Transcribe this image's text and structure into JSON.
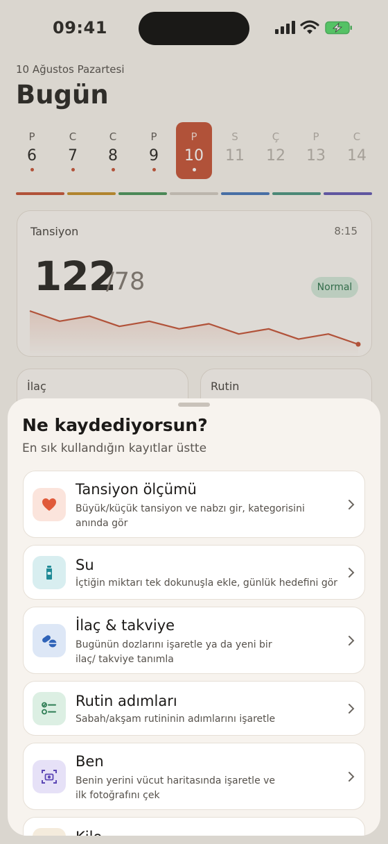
{
  "status_bar": {
    "time": "09:41"
  },
  "header": {
    "date": "10 Ağustos Pazartesi",
    "title": "Bugün"
  },
  "week": [
    {
      "letter": "P",
      "number": "6",
      "state": "past"
    },
    {
      "letter": "C",
      "number": "7",
      "state": "past"
    },
    {
      "letter": "C",
      "number": "8",
      "state": "past"
    },
    {
      "letter": "P",
      "number": "9",
      "state": "past"
    },
    {
      "letter": "P",
      "number": "10",
      "state": "today"
    },
    {
      "letter": "S",
      "number": "11",
      "state": "future"
    },
    {
      "letter": "Ç",
      "number": "12",
      "state": "future"
    },
    {
      "letter": "P",
      "number": "13",
      "state": "future"
    },
    {
      "letter": "C",
      "number": "14",
      "state": "future"
    }
  ],
  "category_colors": [
    "#c2492c",
    "#c28a1e",
    "#3f8f52",
    "#cfc8bf",
    "#3b6fb6",
    "#3f8f7a",
    "#5a4fb0"
  ],
  "bp_card": {
    "title": "Tansiyon",
    "time": "8:15",
    "systolic": "122",
    "diastolic": "/78",
    "status": "Normal",
    "trend": [
      15,
      17,
      16,
      18,
      17,
      18.5,
      17.5,
      19.5,
      18.5,
      20.5,
      19.5,
      21.5
    ]
  },
  "small_cards": {
    "medication": "İlaç",
    "routine": "Rutin"
  },
  "sheet": {
    "title": "Ne kaydediyorsun?",
    "subtitle": "En sık kullandığın kayıtlar üstte",
    "items": [
      {
        "title": "Tansiyon ölçümü",
        "desc": "Büyük/küçük tansiyon ve nabzı gir, kategorisini anında gör",
        "icon": "heart-icon",
        "color": "#e05a3a",
        "bg": "#fbe4dc"
      },
      {
        "title": "Su",
        "desc": "İçtiğin miktarı tek dokunuşla ekle, günlük hedefini gör",
        "icon": "water-bottle-icon",
        "color": "#1f8a96",
        "bg": "#d8eef0"
      },
      {
        "title": "İlaç & takviye",
        "desc": "Bugünün dozlarını işaretle ya da yeni bir ilaç/ takviye tanımla",
        "icon": "pills-icon",
        "color": "#2f63b8",
        "bg": "#dde7f6"
      },
      {
        "title": "Rutin adımları",
        "desc": "Sabah/akşam rutininin adımlarını işaretle",
        "icon": "checklist-icon",
        "color": "#2e7d54",
        "bg": "#dcefe3"
      },
      {
        "title": "Ben",
        "desc": "Benin yerini vücut haritasında işaretle ve ilk fotoğrafını çek",
        "icon": "camera-scan-icon",
        "color": "#5b46b4",
        "bg": "#e6e1f7"
      },
      {
        "title": "Kilo",
        "desc": "",
        "icon": "scale-icon",
        "color": "#b8862e",
        "bg": "#f4ebdc"
      }
    ]
  }
}
